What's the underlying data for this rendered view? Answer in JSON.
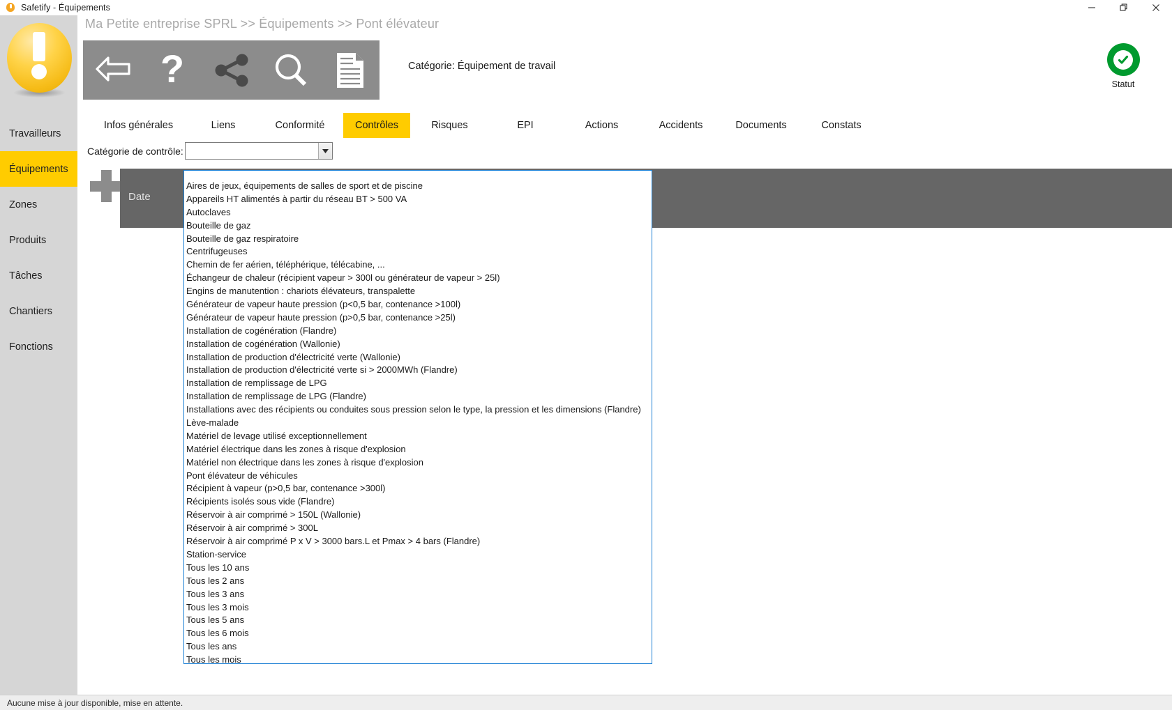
{
  "window": {
    "title": "Safetify - Équipements",
    "app_icon": "bulb-icon",
    "controls": {
      "minimize": "minimize-icon",
      "maximize": "restore-icon",
      "close": "close-icon"
    }
  },
  "sidebar": {
    "logo": "exclamation-ball-logo",
    "items": [
      {
        "label": "Travailleurs",
        "active": false
      },
      {
        "label": "Équipements",
        "active": true
      },
      {
        "label": "Zones",
        "active": false
      },
      {
        "label": "Produits",
        "active": false
      },
      {
        "label": "Tâches",
        "active": false
      },
      {
        "label": "Chantiers",
        "active": false
      },
      {
        "label": "Fonctions",
        "active": false
      }
    ]
  },
  "header": {
    "breadcrumb": "Ma Petite entreprise SPRL >> Équipements >> Pont élévateur",
    "category_text": "Catégorie: Équipement de travail",
    "status": {
      "label": "Statut",
      "icon": "check-circle-icon",
      "color": "#009a2e"
    },
    "toolbar": [
      {
        "icon": "back-arrow-icon",
        "name": "back-button"
      },
      {
        "icon": "question-mark-icon",
        "name": "help-button"
      },
      {
        "icon": "share-icon",
        "name": "share-button"
      },
      {
        "icon": "magnifier-icon",
        "name": "search-button"
      },
      {
        "icon": "document-icon",
        "name": "report-button"
      }
    ]
  },
  "tabs": [
    {
      "label": "Infos générales",
      "active": false
    },
    {
      "label": "Liens",
      "active": false
    },
    {
      "label": "Conformité",
      "active": false
    },
    {
      "label": "Contrôles",
      "active": true
    },
    {
      "label": "Risques",
      "active": false
    },
    {
      "label": "EPI",
      "active": false
    },
    {
      "label": "Actions",
      "active": false
    },
    {
      "label": "Accidents",
      "active": false
    },
    {
      "label": "Documents",
      "active": false
    },
    {
      "label": "Constats",
      "active": false
    }
  ],
  "content": {
    "control_category_label": "Catégorie de contrôle:",
    "combo_value": "",
    "combo_placeholder": "",
    "combo_arrow_icon": "chevron-down-icon",
    "add_button_icon": "plus-icon",
    "table_columns": [
      "Date"
    ]
  },
  "dropdown": {
    "options": [
      "Aires de jeux, équipements de salles de sport et de piscine",
      "Appareils HT alimentés à partir du réseau BT > 500 VA",
      "Autoclaves",
      "Bouteille de gaz",
      "Bouteille de gaz respiratoire",
      "Centrifugeuses",
      "Chemin de fer aérien, téléphérique, télécabine, ...",
      "Échangeur de chaleur (récipient vapeur > 300l ou générateur de vapeur > 25l)",
      "Engins de manutention : chariots élévateurs, transpalette",
      "Générateur de vapeur haute pression (p<0,5 bar, contenance >100l)",
      "Générateur de vapeur haute pression (p>0,5 bar, contenance >25l)",
      "Installation de cogénération (Flandre)",
      "Installation de cogénération (Wallonie)",
      "Installation de production d'électricité verte (Wallonie)",
      "Installation de production d'électricité verte si > 2000MWh (Flandre)",
      "Installation de remplissage de LPG",
      "Installation de remplissage de LPG (Flandre)",
      "Installations avec des récipients ou conduites sous pression selon le type, la pression et les dimensions (Flandre)",
      "Lève-malade",
      "Matériel de levage utilisé exceptionnellement",
      "Matériel électrique dans les zones à risque d'explosion",
      "Matériel non électrique dans les zones à risque d'explosion",
      "Pont élévateur de véhicules",
      "Récipient à vapeur (p>0,5 bar, contenance >300l)",
      "Récipients isolés sous vide (Flandre)",
      "Réservoir à air comprimé > 150L (Wallonie)",
      "Réservoir à air comprimé > 300L",
      "Réservoir à air comprimé P x V > 3000 bars.L et Pmax > 4 bars (Flandre)",
      "Station-service",
      "Tous les 10 ans",
      "Tous les 2 ans",
      "Tous les 3 ans",
      "Tous les 3 mois",
      "Tous les 5 ans",
      "Tous les 6 mois",
      "Tous les ans",
      "Tous les mois"
    ]
  },
  "statusbar": {
    "message": "Aucune mise à jour disponible, mise en attente."
  },
  "colors": {
    "accent_yellow": "#ffcc00",
    "sidebar_gray": "#d6d6d6",
    "toolbar_gray": "#8c8c8c",
    "table_header_gray": "#666666",
    "dropdown_border_blue": "#1a7fd4",
    "status_green": "#009a2e"
  }
}
